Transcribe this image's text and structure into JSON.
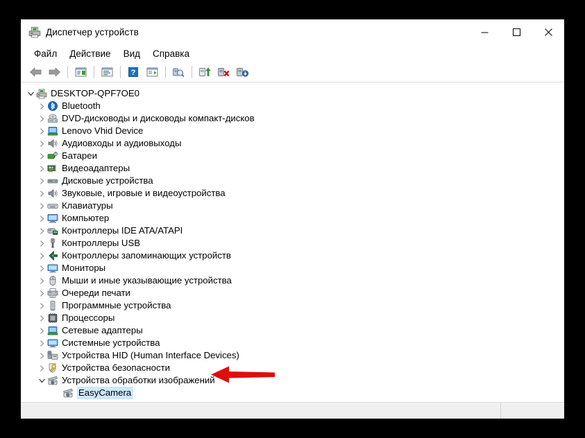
{
  "window": {
    "title": "Диспетчер устройств",
    "title_icon": "device-manager-icon",
    "caption": {
      "minimize": "—",
      "maximize": "▢",
      "close": "✕"
    }
  },
  "menubar": {
    "items": [
      {
        "label": "Файл"
      },
      {
        "label": "Действие"
      },
      {
        "label": "Вид"
      },
      {
        "label": "Справка"
      }
    ]
  },
  "toolbar": {
    "buttons": [
      {
        "name": "back-icon",
        "tooltip": "Назад"
      },
      {
        "name": "forward-icon",
        "tooltip": "Вперед"
      },
      {
        "name": "separator-1"
      },
      {
        "name": "show-hide-console-tree-icon",
        "tooltip": "Показать/скрыть дерево консоли"
      },
      {
        "name": "separator-2"
      },
      {
        "name": "properties-icon",
        "tooltip": "Свойства"
      },
      {
        "name": "separator-3"
      },
      {
        "name": "help-icon",
        "tooltip": "Справка"
      },
      {
        "name": "show-hide-action-pane-icon",
        "tooltip": "Показать/скрыть область действий"
      },
      {
        "name": "separator-4"
      },
      {
        "name": "scan-for-hardware-changes-icon",
        "tooltip": "Обновить конфигурацию оборудования"
      },
      {
        "name": "separator-5"
      },
      {
        "name": "update-driver-icon",
        "tooltip": "Обновить драйвер"
      },
      {
        "name": "uninstall-device-icon",
        "tooltip": "Удалить устройство"
      },
      {
        "name": "disable-device-icon",
        "tooltip": "Отключить устройство"
      }
    ]
  },
  "tree": {
    "root": {
      "label": "DESKTOP-QPF7OE0",
      "icon": "computer-root-icon",
      "expanded": true,
      "chevron": "chevron-down"
    },
    "items": [
      {
        "label": "Bluetooth",
        "icon": "bluetooth-icon",
        "expanded": false,
        "chevron": "chevron-right",
        "indent": 1
      },
      {
        "label": "DVD-дисководы и дисководы компакт-дисков",
        "icon": "dvd-drive-icon",
        "expanded": false,
        "chevron": "chevron-right",
        "indent": 1
      },
      {
        "label": "Lenovo Vhid Device",
        "icon": "lenovo-device-icon",
        "expanded": false,
        "chevron": "chevron-right",
        "indent": 1
      },
      {
        "label": "Аудиовходы и аудиовыходы",
        "icon": "audio-io-icon",
        "expanded": false,
        "chevron": "chevron-right",
        "indent": 1
      },
      {
        "label": "Батареи",
        "icon": "battery-icon",
        "expanded": false,
        "chevron": "chevron-right",
        "indent": 1
      },
      {
        "label": "Видеоадаптеры",
        "icon": "display-adapter-icon",
        "expanded": false,
        "chevron": "chevron-right",
        "indent": 1
      },
      {
        "label": "Дисковые устройства",
        "icon": "disk-drive-icon",
        "expanded": false,
        "chevron": "chevron-right",
        "indent": 1
      },
      {
        "label": "Звуковые, игровые и видеоустройства",
        "icon": "sound-video-game-icon",
        "expanded": false,
        "chevron": "chevron-right",
        "indent": 1
      },
      {
        "label": "Клавиатуры",
        "icon": "keyboard-icon",
        "expanded": false,
        "chevron": "chevron-right",
        "indent": 1
      },
      {
        "label": "Компьютер",
        "icon": "computer-icon",
        "expanded": false,
        "chevron": "chevron-right",
        "indent": 1
      },
      {
        "label": "Контроллеры IDE ATA/ATAPI",
        "icon": "ide-controller-icon",
        "expanded": false,
        "chevron": "chevron-right",
        "indent": 1
      },
      {
        "label": "Контроллеры USB",
        "icon": "usb-controller-icon",
        "expanded": false,
        "chevron": "chevron-right",
        "indent": 1
      },
      {
        "label": "Контроллеры запоминающих устройств",
        "icon": "storage-controller-icon",
        "expanded": false,
        "chevron": "chevron-right",
        "indent": 1
      },
      {
        "label": "Мониторы",
        "icon": "monitor-icon",
        "expanded": false,
        "chevron": "chevron-right",
        "indent": 1
      },
      {
        "label": "Мыши и иные указывающие устройства",
        "icon": "mouse-icon",
        "expanded": false,
        "chevron": "chevron-right",
        "indent": 1
      },
      {
        "label": "Очереди печати",
        "icon": "print-queue-icon",
        "expanded": false,
        "chevron": "chevron-right",
        "indent": 1
      },
      {
        "label": "Программные устройства",
        "icon": "software-device-icon",
        "expanded": false,
        "chevron": "chevron-right",
        "indent": 1
      },
      {
        "label": "Процессоры",
        "icon": "processor-icon",
        "expanded": false,
        "chevron": "chevron-right",
        "indent": 1
      },
      {
        "label": "Сетевые адаптеры",
        "icon": "network-adapter-icon",
        "expanded": false,
        "chevron": "chevron-right",
        "indent": 1
      },
      {
        "label": "Системные устройства",
        "icon": "system-device-icon",
        "expanded": false,
        "chevron": "chevron-right",
        "indent": 1
      },
      {
        "label": "Устройства HID (Human Interface Devices)",
        "icon": "hid-device-icon",
        "expanded": false,
        "chevron": "chevron-right",
        "indent": 1
      },
      {
        "label": "Устройства безопасности",
        "icon": "security-device-icon",
        "expanded": false,
        "chevron": "chevron-right",
        "indent": 1
      },
      {
        "label": "Устройства обработки изображений",
        "icon": "imaging-device-icon",
        "expanded": true,
        "chevron": "chevron-down",
        "indent": 1,
        "annotated": true
      },
      {
        "label": "EasyCamera",
        "icon": "camera-icon",
        "expanded": null,
        "chevron": "none",
        "indent": 2,
        "selected": true
      }
    ]
  },
  "statusbar": {
    "pane_1": "",
    "pane_2": ""
  },
  "annotation": {
    "arrow": "red-left-arrow",
    "color": "#e00d0d"
  },
  "colors": {
    "selection": "#cde8ff",
    "window_bg": "#ffffff",
    "statusbar_bg": "#f0f0f0",
    "outer_bg": "#000000",
    "accent_red": "#e00d0d"
  }
}
